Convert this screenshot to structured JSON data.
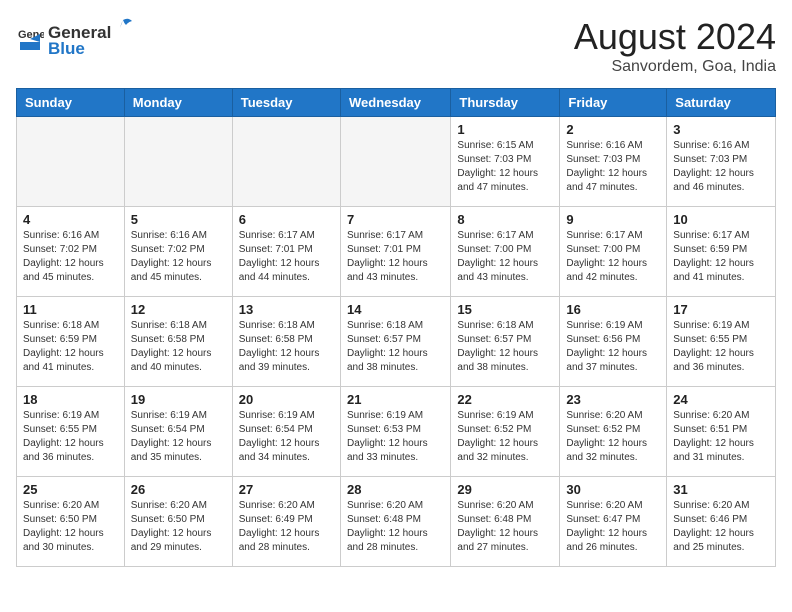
{
  "header": {
    "logo_general": "General",
    "logo_blue": "Blue",
    "month_year": "August 2024",
    "location": "Sanvordem, Goa, India"
  },
  "weekdays": [
    "Sunday",
    "Monday",
    "Tuesday",
    "Wednesday",
    "Thursday",
    "Friday",
    "Saturday"
  ],
  "weeks": [
    [
      {
        "day": "",
        "info": ""
      },
      {
        "day": "",
        "info": ""
      },
      {
        "day": "",
        "info": ""
      },
      {
        "day": "",
        "info": ""
      },
      {
        "day": "1",
        "info": "Sunrise: 6:15 AM\nSunset: 7:03 PM\nDaylight: 12 hours\nand 47 minutes."
      },
      {
        "day": "2",
        "info": "Sunrise: 6:16 AM\nSunset: 7:03 PM\nDaylight: 12 hours\nand 47 minutes."
      },
      {
        "day": "3",
        "info": "Sunrise: 6:16 AM\nSunset: 7:03 PM\nDaylight: 12 hours\nand 46 minutes."
      }
    ],
    [
      {
        "day": "4",
        "info": "Sunrise: 6:16 AM\nSunset: 7:02 PM\nDaylight: 12 hours\nand 45 minutes."
      },
      {
        "day": "5",
        "info": "Sunrise: 6:16 AM\nSunset: 7:02 PM\nDaylight: 12 hours\nand 45 minutes."
      },
      {
        "day": "6",
        "info": "Sunrise: 6:17 AM\nSunset: 7:01 PM\nDaylight: 12 hours\nand 44 minutes."
      },
      {
        "day": "7",
        "info": "Sunrise: 6:17 AM\nSunset: 7:01 PM\nDaylight: 12 hours\nand 43 minutes."
      },
      {
        "day": "8",
        "info": "Sunrise: 6:17 AM\nSunset: 7:00 PM\nDaylight: 12 hours\nand 43 minutes."
      },
      {
        "day": "9",
        "info": "Sunrise: 6:17 AM\nSunset: 7:00 PM\nDaylight: 12 hours\nand 42 minutes."
      },
      {
        "day": "10",
        "info": "Sunrise: 6:17 AM\nSunset: 6:59 PM\nDaylight: 12 hours\nand 41 minutes."
      }
    ],
    [
      {
        "day": "11",
        "info": "Sunrise: 6:18 AM\nSunset: 6:59 PM\nDaylight: 12 hours\nand 41 minutes."
      },
      {
        "day": "12",
        "info": "Sunrise: 6:18 AM\nSunset: 6:58 PM\nDaylight: 12 hours\nand 40 minutes."
      },
      {
        "day": "13",
        "info": "Sunrise: 6:18 AM\nSunset: 6:58 PM\nDaylight: 12 hours\nand 39 minutes."
      },
      {
        "day": "14",
        "info": "Sunrise: 6:18 AM\nSunset: 6:57 PM\nDaylight: 12 hours\nand 38 minutes."
      },
      {
        "day": "15",
        "info": "Sunrise: 6:18 AM\nSunset: 6:57 PM\nDaylight: 12 hours\nand 38 minutes."
      },
      {
        "day": "16",
        "info": "Sunrise: 6:19 AM\nSunset: 6:56 PM\nDaylight: 12 hours\nand 37 minutes."
      },
      {
        "day": "17",
        "info": "Sunrise: 6:19 AM\nSunset: 6:55 PM\nDaylight: 12 hours\nand 36 minutes."
      }
    ],
    [
      {
        "day": "18",
        "info": "Sunrise: 6:19 AM\nSunset: 6:55 PM\nDaylight: 12 hours\nand 36 minutes."
      },
      {
        "day": "19",
        "info": "Sunrise: 6:19 AM\nSunset: 6:54 PM\nDaylight: 12 hours\nand 35 minutes."
      },
      {
        "day": "20",
        "info": "Sunrise: 6:19 AM\nSunset: 6:54 PM\nDaylight: 12 hours\nand 34 minutes."
      },
      {
        "day": "21",
        "info": "Sunrise: 6:19 AM\nSunset: 6:53 PM\nDaylight: 12 hours\nand 33 minutes."
      },
      {
        "day": "22",
        "info": "Sunrise: 6:19 AM\nSunset: 6:52 PM\nDaylight: 12 hours\nand 32 minutes."
      },
      {
        "day": "23",
        "info": "Sunrise: 6:20 AM\nSunset: 6:52 PM\nDaylight: 12 hours\nand 32 minutes."
      },
      {
        "day": "24",
        "info": "Sunrise: 6:20 AM\nSunset: 6:51 PM\nDaylight: 12 hours\nand 31 minutes."
      }
    ],
    [
      {
        "day": "25",
        "info": "Sunrise: 6:20 AM\nSunset: 6:50 PM\nDaylight: 12 hours\nand 30 minutes."
      },
      {
        "day": "26",
        "info": "Sunrise: 6:20 AM\nSunset: 6:50 PM\nDaylight: 12 hours\nand 29 minutes."
      },
      {
        "day": "27",
        "info": "Sunrise: 6:20 AM\nSunset: 6:49 PM\nDaylight: 12 hours\nand 28 minutes."
      },
      {
        "day": "28",
        "info": "Sunrise: 6:20 AM\nSunset: 6:48 PM\nDaylight: 12 hours\nand 28 minutes."
      },
      {
        "day": "29",
        "info": "Sunrise: 6:20 AM\nSunset: 6:48 PM\nDaylight: 12 hours\nand 27 minutes."
      },
      {
        "day": "30",
        "info": "Sunrise: 6:20 AM\nSunset: 6:47 PM\nDaylight: 12 hours\nand 26 minutes."
      },
      {
        "day": "31",
        "info": "Sunrise: 6:20 AM\nSunset: 6:46 PM\nDaylight: 12 hours\nand 25 minutes."
      }
    ]
  ]
}
